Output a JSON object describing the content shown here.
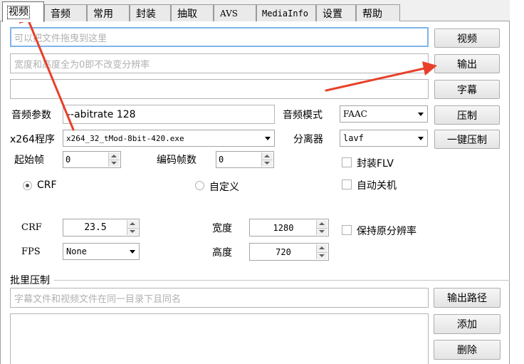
{
  "tabs": [
    {
      "label": "视频"
    },
    {
      "label": "音频"
    },
    {
      "label": "常用"
    },
    {
      "label": "封装"
    },
    {
      "label": "抽取"
    },
    {
      "label": "AVS"
    },
    {
      "label": "MediaInfo"
    },
    {
      "label": "设置"
    },
    {
      "label": "帮助"
    }
  ],
  "video": {
    "file_input": {
      "placeholder": "可以把文件拖曳到这里"
    },
    "resolution_input": {
      "placeholder": "宽度和高度全为0即不改变分辨率"
    },
    "subtitle_input": {
      "value": ""
    },
    "buttons": {
      "video": "视频",
      "output": "输出",
      "subtitle": "字幕",
      "compress": "压制",
      "one_click": "一键压制"
    },
    "audio_params": {
      "label": "音频参数",
      "value": "--abitrate 128"
    },
    "audio_mode": {
      "label": "音频模式",
      "selected": "FAAC"
    },
    "x264": {
      "label": "x264程序",
      "selected": "x264_32_tMod-8bit-420.exe"
    },
    "demuxer": {
      "label": "分离器",
      "selected": "lavf"
    },
    "start_frame": {
      "label": "起始帧",
      "value": "0"
    },
    "encode_frames": {
      "label": "编码帧数",
      "value": "0"
    },
    "flv": {
      "label": "封装FLV",
      "checked": false
    },
    "shutdown": {
      "label": "自动关机",
      "checked": false
    },
    "mode_crf": {
      "label": "CRF",
      "checked": true
    },
    "mode_custom": {
      "label": "自定义",
      "checked": false
    },
    "crf": {
      "label": "CRF",
      "value": "23.5"
    },
    "fps": {
      "label": "FPS",
      "selected": "None"
    },
    "width": {
      "label": "宽度",
      "value": "1280"
    },
    "height": {
      "label": "高度",
      "value": "720"
    },
    "keep_res": {
      "label": "保持原分辨率",
      "checked": false
    }
  },
  "batch": {
    "title": "批里压制",
    "hint_input": {
      "placeholder": "字幕文件和视频文件在同一目录下且同名"
    },
    "buttons": {
      "output_path": "输出路径",
      "add": "添加",
      "delete": "删除"
    }
  },
  "colors": {
    "annotation_arrow": "#e8402a",
    "focus_border": "#7eb4ea"
  }
}
